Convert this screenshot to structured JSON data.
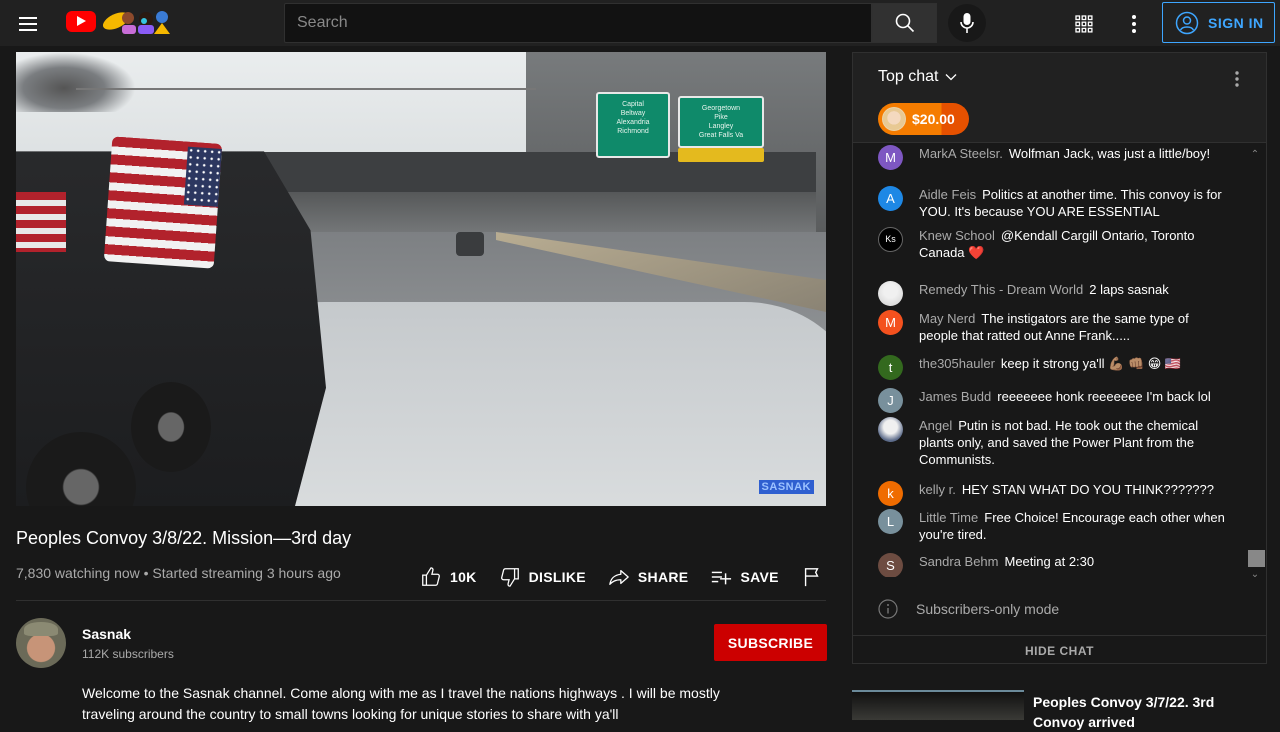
{
  "header": {
    "search_placeholder": "Search",
    "signin_label": "SIGN IN",
    "colors": {
      "accent": "#3ea6ff",
      "logo_red": "#ff0000",
      "bg": "#212121"
    }
  },
  "video": {
    "title": "Peoples Convoy 3/8/22. Mission—3rd day",
    "meta": "7,830 watching now • Started streaming 3 hours ago",
    "watermark": "SASNAK",
    "signs": {
      "left": [
        "Capital",
        "Beltway",
        "Alexandria",
        "Richmond"
      ],
      "right": [
        "Georgetown",
        "Pike",
        "Langley",
        "Great Falls Va"
      ]
    },
    "actions": {
      "like": "10K",
      "dislike": "DISLIKE",
      "share": "SHARE",
      "save": "SAVE"
    }
  },
  "channel": {
    "name": "Sasnak",
    "subscribers": "112K subscribers",
    "subscribe_label": "SUBSCRIBE",
    "subscribe_color": "#cc0000",
    "description": "Welcome to the Sasnak channel.  Come along with me as I travel the nations highways .  I will be mostly traveling around the country to small towns looking for unique stories to share with ya'll"
  },
  "chat": {
    "mode_label": "Top chat",
    "ticker": {
      "amount": "$20.00",
      "color": "#f57c00"
    },
    "messages": [
      {
        "author": "MarkA Steelsr.",
        "initial": "M",
        "color": "#7e57c2",
        "text": "Wolfman Jack, was just a little/boy!"
      },
      {
        "author": "Aidle Feis",
        "initial": "A",
        "color": "#1e88e5",
        "text": "Politics at another time. This convoy is for YOU. It's because YOU ARE ESSENTIAL"
      },
      {
        "author": "Knew School",
        "initial": "Ks",
        "color": "#000000",
        "text": "@Kendall Cargill Ontario, Toronto Canada ❤️"
      },
      {
        "author": "Remedy This - Dream World",
        "initial": "",
        "color": "#dddddd",
        "text": "2 laps sasnak"
      },
      {
        "author": "May Nerd",
        "initial": "M",
        "color": "#f4511e",
        "text": "The instigators are the same type of people that ratted out Anne Frank....."
      },
      {
        "author": "the305hauler",
        "initial": "t",
        "color": "#33691e",
        "text": "keep it strong ya'll 💪🏽 👊🏽 😁 🇺🇸"
      },
      {
        "author": "James Budd",
        "initial": "J",
        "color": "#78909c",
        "text": "reeeeeee honk reeeeeee I'm back lol"
      },
      {
        "author": "Angel",
        "initial": "",
        "color": "#5c6b8a",
        "text": "Putin is not bad. He took out the chemical plants only, and saved the Power Plant from the Communists."
      },
      {
        "author": "kelly r.",
        "initial": "k",
        "color": "#ef6c00",
        "text": "HEY STAN WHAT DO YOU THINK???????"
      },
      {
        "author": "Little Time",
        "initial": "L",
        "color": "#78909c",
        "text": "Free Choice! Encourage each other when you're tired."
      },
      {
        "author": "Sandra Behm",
        "initial": "S",
        "color": "#6d4c41",
        "text": "Meeting at 2:30"
      }
    ],
    "subscribers_only_label": "Subscribers-only mode",
    "hide_chat_label": "HIDE CHAT"
  },
  "recommendations": [
    {
      "title": "Peoples Convoy 3/7/22. 3rd Convoy arrived"
    }
  ]
}
